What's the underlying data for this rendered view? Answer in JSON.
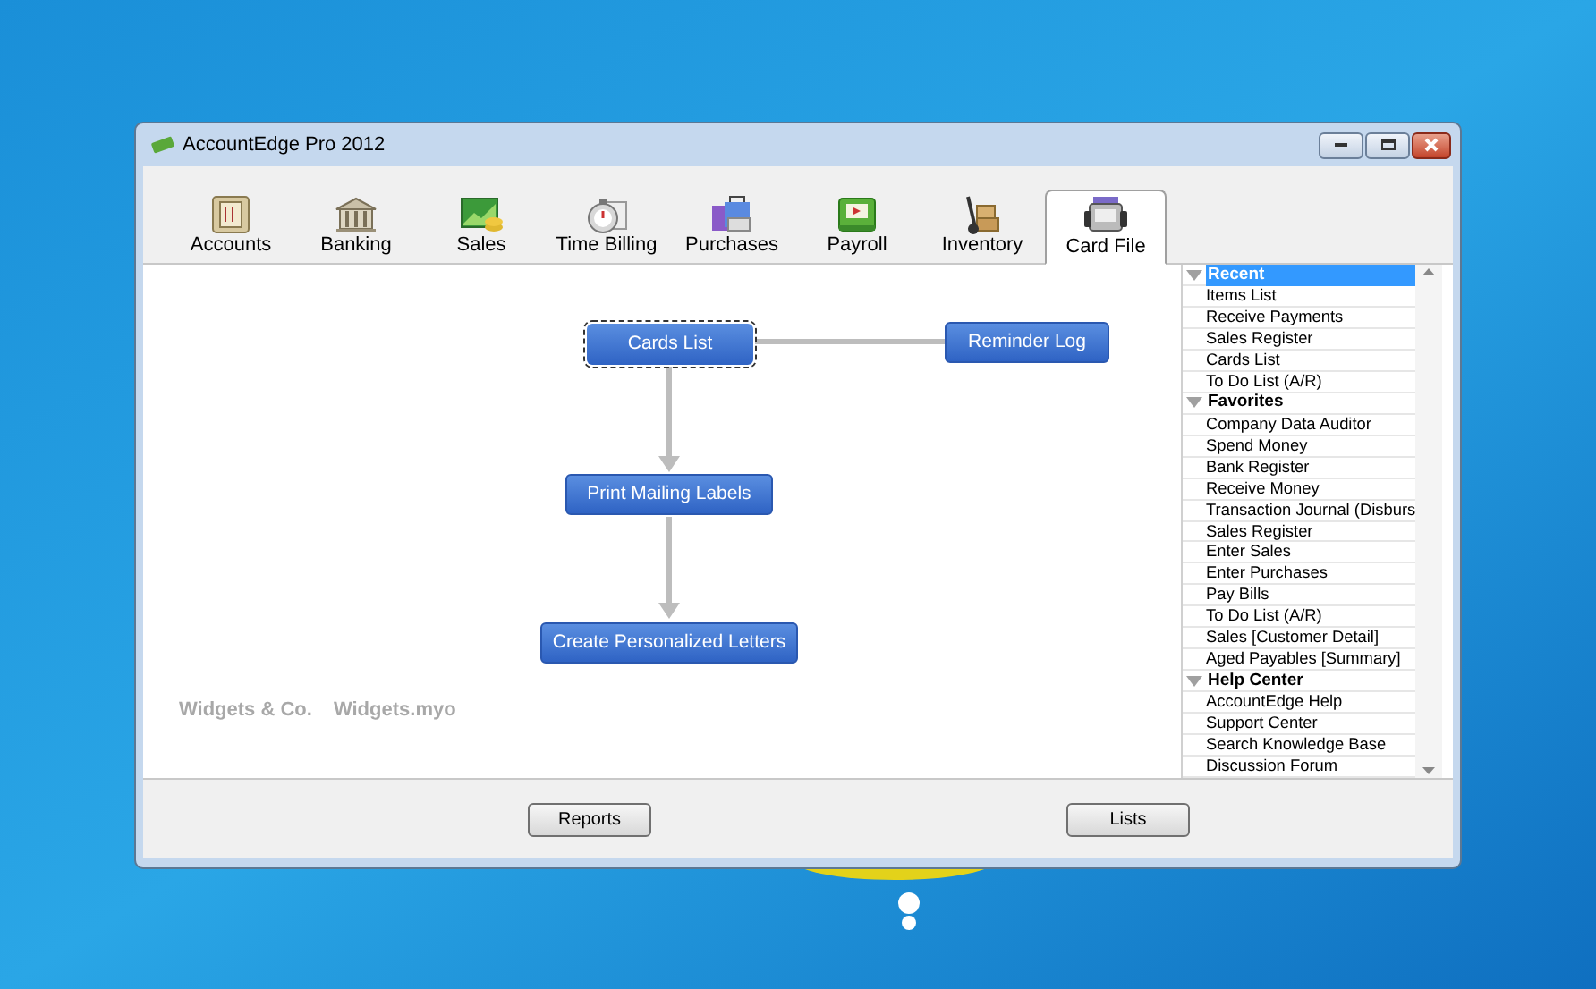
{
  "window": {
    "title": "AccountEdge Pro 2012"
  },
  "tabs": [
    {
      "label": "Accounts",
      "selected": false
    },
    {
      "label": "Banking",
      "selected": false
    },
    {
      "label": "Sales",
      "selected": false
    },
    {
      "label": "Time Billing",
      "selected": false
    },
    {
      "label": "Purchases",
      "selected": false
    },
    {
      "label": "Payroll",
      "selected": false
    },
    {
      "label": "Inventory",
      "selected": false
    },
    {
      "label": "Card File",
      "selected": true
    }
  ],
  "flowchart": {
    "nodes": [
      {
        "label": "Cards List",
        "focused": true
      },
      {
        "label": "Reminder Log",
        "focused": false
      },
      {
        "label": "Print Mailing Labels",
        "focused": false
      },
      {
        "label": "Create Personalized Letters",
        "focused": false
      }
    ]
  },
  "company_file": [
    "Widgets & Co.",
    "Widgets.myo"
  ],
  "sidebar": {
    "sections": [
      {
        "title": "Recent",
        "selected": true,
        "children": [
          "Items List",
          "Receive Payments",
          "Sales Register",
          "Cards List",
          "To Do List (A/R)"
        ]
      },
      {
        "title": "Favorites",
        "selected": false,
        "children": [
          "Company Data Auditor",
          "Spend Money",
          "Bank Register",
          "Receive Money",
          "Transaction Journal (Disburs",
          "Sales Register",
          "Enter Sales",
          "Enter Purchases",
          "Pay Bills",
          "To Do List (A/R)",
          "Sales [Customer Detail]",
          "Aged Payables [Summary]"
        ]
      },
      {
        "title": "Help Center",
        "selected": false,
        "children": [
          "AccountEdge Help",
          "Support Center",
          "Search Knowledge Base",
          "Discussion Forum"
        ]
      }
    ]
  },
  "buttons": [
    "Reports",
    "Lists"
  ]
}
